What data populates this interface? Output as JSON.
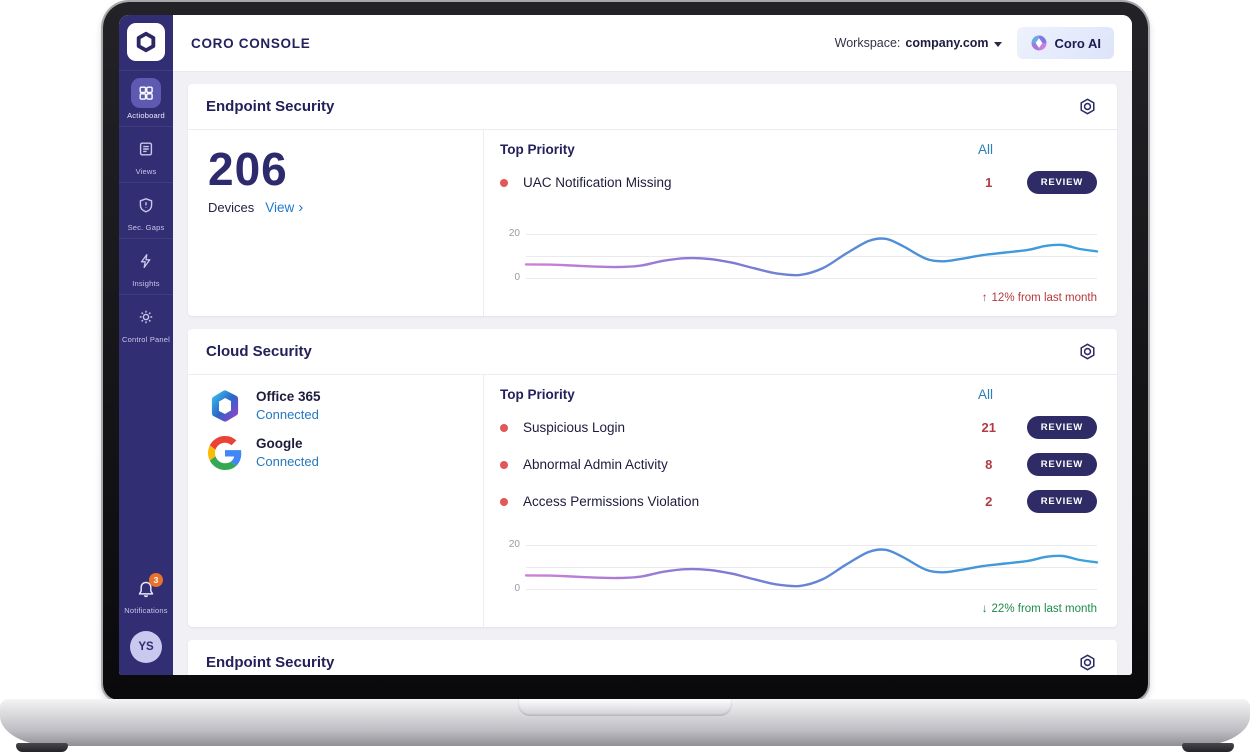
{
  "header": {
    "app_title": "CORO CONSOLE",
    "workspace_label": "Workspace:",
    "workspace_value": "company.com",
    "coro_ai_label": "Coro AI"
  },
  "sidebar": {
    "items": [
      {
        "label": "Actioboard",
        "icon": "grid-icon"
      },
      {
        "label": "Views",
        "icon": "views-icon"
      },
      {
        "label": "Sec. Gaps",
        "icon": "shield-icon"
      },
      {
        "label": "Insights",
        "icon": "lightning-icon"
      },
      {
        "label": "Control Panel",
        "icon": "gear-icon"
      }
    ],
    "notifications_label": "Notifications",
    "notifications_badge": "3",
    "avatar_initials": "YS"
  },
  "labels": {
    "top_priority": "Top Priority",
    "all": "All",
    "review": "REVIEW"
  },
  "cards": [
    {
      "title": "Endpoint Security",
      "stat_value": "206",
      "stat_label": "Devices",
      "stat_link": "View",
      "stat_link_chevron": "›",
      "priorities": [
        {
          "label": "UAC Notification Missing",
          "count": "1"
        }
      ],
      "trend": {
        "arrow": "↑",
        "text": "12% from last month",
        "color": "#b5383d"
      }
    },
    {
      "title": "Cloud Security",
      "services": [
        {
          "name": "Office 365",
          "status": "Connected",
          "icon": "office-365-logo"
        },
        {
          "name": "Google",
          "status": "Connected",
          "icon": "google-logo"
        }
      ],
      "priorities": [
        {
          "label": "Suspicious Login",
          "count": "21"
        },
        {
          "label": "Abnormal Admin Activity",
          "count": "8"
        },
        {
          "label": "Access Permissions Violation",
          "count": "2"
        }
      ],
      "trend": {
        "arrow": "↓",
        "text": "22% from last month",
        "color": "#1e8a4c"
      }
    },
    {
      "title": "Endpoint Security"
    }
  ],
  "chart_data": [
    {
      "type": "line",
      "x": [
        0,
        4,
        8,
        12,
        16,
        20,
        24,
        28,
        32,
        36,
        40,
        44,
        48,
        52,
        56,
        60,
        63,
        66,
        70,
        73,
        76,
        80,
        84,
        88,
        91,
        94,
        97,
        100
      ],
      "values": [
        6.2,
        6.1,
        5.7,
        5.2,
        5.0,
        5.6,
        7.8,
        9.0,
        8.7,
        7.0,
        4.4,
        2.0,
        1.4,
        4.5,
        11.0,
        16.8,
        17.8,
        14.5,
        8.8,
        7.6,
        8.6,
        10.4,
        11.6,
        12.8,
        14.6,
        15.0,
        13.2,
        12.1
      ],
      "ylim": [
        0,
        20
      ],
      "ytick_labels": [
        "20",
        "0"
      ],
      "gridline_values": [
        20,
        10,
        0
      ],
      "grid": true,
      "legend": false,
      "annotation": "↑ 12% from last month",
      "line_gradient": [
        "#d07fd6",
        "#8279d4",
        "#4b90d8",
        "#38a2dc"
      ]
    },
    {
      "type": "line",
      "x": [
        0,
        4,
        8,
        12,
        16,
        20,
        24,
        28,
        32,
        36,
        40,
        44,
        48,
        52,
        56,
        60,
        63,
        66,
        70,
        73,
        76,
        80,
        84,
        88,
        91,
        94,
        97,
        100
      ],
      "values": [
        6.2,
        6.1,
        5.7,
        5.2,
        5.0,
        5.6,
        7.8,
        9.0,
        8.7,
        7.0,
        4.4,
        2.0,
        1.4,
        4.5,
        11.0,
        16.8,
        17.8,
        14.5,
        8.8,
        7.6,
        8.6,
        10.4,
        11.6,
        12.8,
        14.6,
        15.0,
        13.2,
        12.1
      ],
      "ylim": [
        0,
        20
      ],
      "ytick_labels": [
        "20",
        "0"
      ],
      "gridline_values": [
        20,
        10,
        0
      ],
      "grid": true,
      "legend": false,
      "annotation": "↓ 22% from last month",
      "line_gradient": [
        "#d07fd6",
        "#8279d4",
        "#4b90d8",
        "#38a2dc"
      ]
    }
  ]
}
